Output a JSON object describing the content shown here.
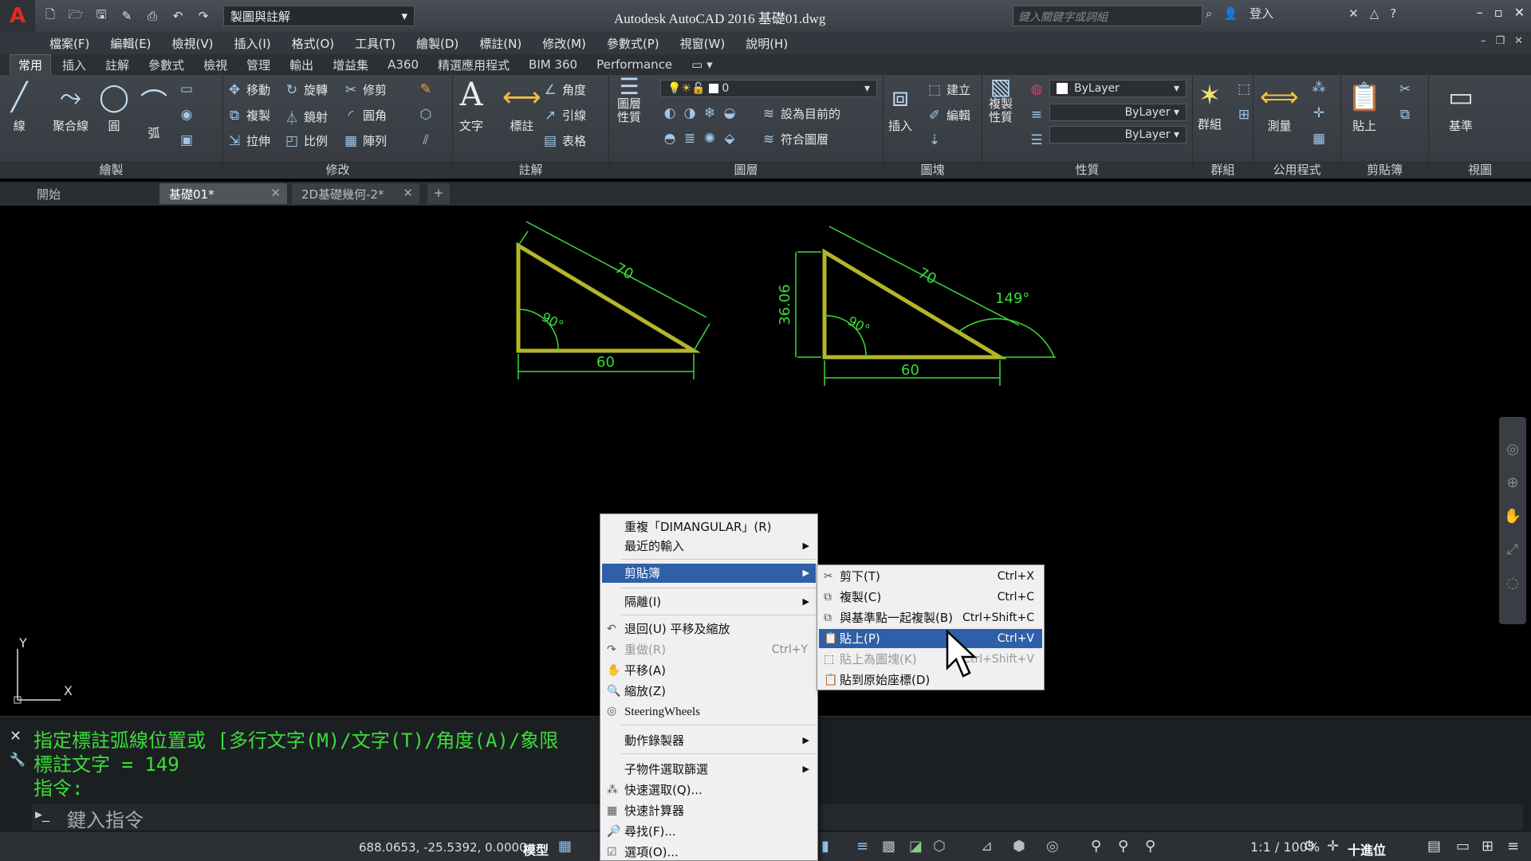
{
  "titlebar": {
    "workspace": "製圖與註解",
    "title": "Autodesk AutoCAD 2016    基礎01.dwg",
    "search_placeholder": "鍵入關鍵字或詞組",
    "login": "登入"
  },
  "menubar": [
    "檔案(F)",
    "編輯(E)",
    "檢視(V)",
    "插入(I)",
    "格式(O)",
    "工具(T)",
    "繪製(D)",
    "標註(N)",
    "修改(M)",
    "參數式(P)",
    "視窗(W)",
    "說明(H)"
  ],
  "ribbon_tabs": [
    "常用",
    "插入",
    "註解",
    "參數式",
    "檢視",
    "管理",
    "輸出",
    "增益集",
    "A360",
    "精選應用程式",
    "BIM 360",
    "Performance"
  ],
  "ribbon": {
    "draw": {
      "title": "繪製",
      "line": "線",
      "polyline": "聚合線",
      "circle": "圓",
      "arc": "弧"
    },
    "modify": {
      "title": "修改",
      "move": "移動",
      "rotate": "旋轉",
      "trim": "修剪",
      "copy": "複製",
      "mirror": "鏡射",
      "fillet": "圓角",
      "stretch": "拉伸",
      "scale": "比例",
      "array": "陣列"
    },
    "annotation": {
      "title": "註解",
      "text": "文字",
      "dimension": "標註",
      "angle": "角度",
      "leader": "引線",
      "table": "表格"
    },
    "layers": {
      "title": "圖層",
      "layer_props": "圖層\n性質",
      "current_layer": "0",
      "set_current": "設為目前的",
      "match_layer": "符合圖層"
    },
    "block": {
      "title": "圖塊",
      "insert": "插入",
      "create": "建立",
      "edit": "編輯"
    },
    "properties": {
      "title": "性質",
      "match": "複製\n性質",
      "color": "ByLayer",
      "linetype": "ByLayer",
      "lineweight": "ByLayer"
    },
    "groups": {
      "title": "群組",
      "group": "群組"
    },
    "utilities": {
      "title": "公用程式",
      "measure": "測量"
    },
    "clipboard": {
      "title": "剪貼簿",
      "paste": "貼上"
    },
    "view": {
      "title": "視圖",
      "base": "基準"
    }
  },
  "doc_tabs": [
    "開始",
    "基礎01*",
    "2D基礎幾何-2*"
  ],
  "drawing": {
    "tri1": {
      "hyp": "70",
      "base": "60",
      "angle": "90°"
    },
    "tri2": {
      "hyp": "70",
      "base": "60",
      "height": "36.06",
      "angle": "90°",
      "arc_angle": "149°"
    }
  },
  "cmdline": {
    "line1": "指定標註弧線位置或 [多行文字(M)/文字(T)/角度(A)/象限",
    "line2": "標註文字 = 149",
    "line3": "指令:",
    "input_placeholder": "鍵入指令"
  },
  "statusbar": {
    "coords": "688.0653, -25.5392, 0.0000",
    "model": "模型",
    "scale": "1:1 / 100%",
    "units": "十進位"
  },
  "context_menu": {
    "repeat": "重複「DIMANGULAR」(R)",
    "recent_input": "最近的輸入",
    "clipboard": "剪貼簿",
    "isolate": "隔離(I)",
    "undo_pan_zoom": "退回(U) 平移及縮放",
    "redo": "重做(R)",
    "redo_shortcut": "Ctrl+Y",
    "pan": "平移(A)",
    "zoom": "縮放(Z)",
    "steering": "SteeringWheels",
    "action_recorder": "動作錄製器",
    "subobject_filter": "子物件選取篩選",
    "quick_select": "快速選取(Q)...",
    "quickcalc": "快速計算器",
    "find": "尋找(F)...",
    "options": "選項(O)..."
  },
  "clipboard_submenu": [
    {
      "label": "剪下(T)",
      "shortcut": "Ctrl+X",
      "state": "normal"
    },
    {
      "label": "複製(C)",
      "shortcut": "Ctrl+C",
      "state": "normal"
    },
    {
      "label": "與基準點一起複製(B)",
      "shortcut": "Ctrl+Shift+C",
      "state": "normal"
    },
    {
      "label": "貼上(P)",
      "shortcut": "Ctrl+V",
      "state": "highlighted"
    },
    {
      "label": "貼上為圖塊(K)",
      "shortcut": "Ctrl+Shift+V",
      "state": "disabled"
    },
    {
      "label": "貼到原始座標(D)",
      "shortcut": "",
      "state": "normal"
    }
  ],
  "colors": {
    "dim": "#3bdc3b",
    "object": "#b5b52a",
    "highlight": "#2f5fa8"
  }
}
